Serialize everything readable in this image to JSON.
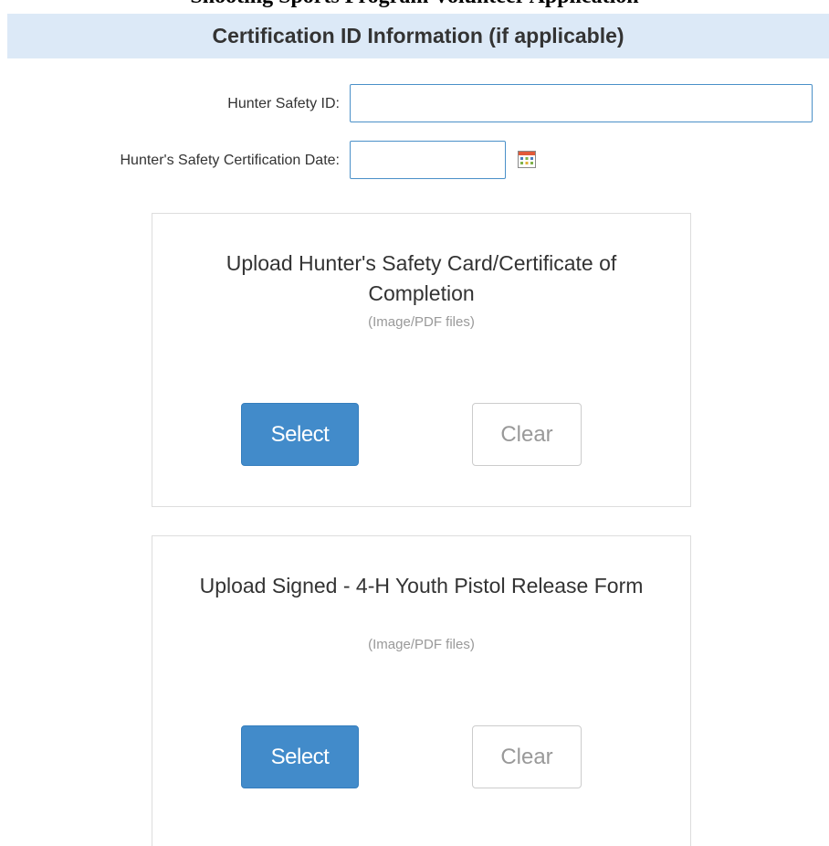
{
  "header": {
    "cut_title": "Shooting Sports Program Volunteer Application",
    "section_title": "Certification ID Information (if applicable)"
  },
  "fields": {
    "hunter_safety_id": {
      "label": "Hunter Safety ID:",
      "value": ""
    },
    "certification_date": {
      "label": "Hunter's Safety Certification Date:",
      "value": ""
    }
  },
  "uploads": [
    {
      "title": "Upload Hunter's Safety Card/Certificate of Completion",
      "hint": "(Image/PDF files)",
      "select_label": "Select",
      "clear_label": "Clear"
    },
    {
      "title": "Upload Signed - 4-H Youth Pistol Release Form",
      "hint": "(Image/PDF files)",
      "select_label": "Select",
      "clear_label": "Clear"
    }
  ],
  "colors": {
    "section_bg": "#dce9f7",
    "primary": "#428bca",
    "input_border": "#4a90c8",
    "panel_border": "#dddddd"
  },
  "icons": {
    "calendar": "calendar-icon"
  }
}
